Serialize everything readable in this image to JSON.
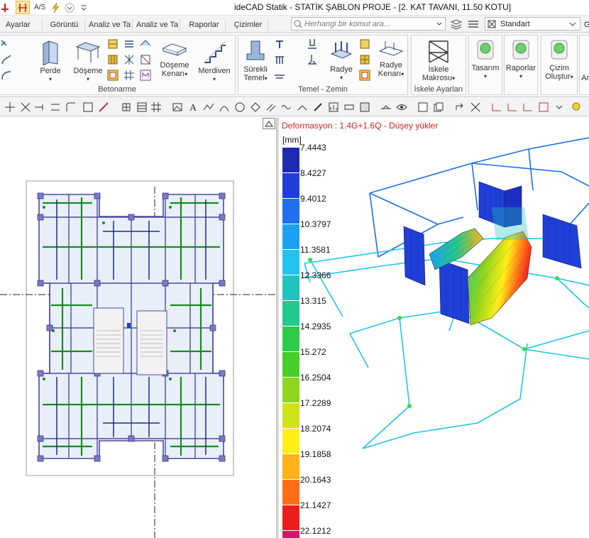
{
  "titlebar": {
    "title": "ideCAD Statik - STATİK ŞABLON PROJE - [2. KAT TAVANI, 11.50 KOTU]",
    "qa_text": "A/S"
  },
  "tabs": [
    "Ayarlar",
    "Görüntü",
    "Analiz ve Ta",
    "Analiz ve Ta",
    "Raporlar",
    "Çizimler"
  ],
  "search": {
    "placeholder": "Herhangi bir komut ara..."
  },
  "style_select": {
    "value": "Standart"
  },
  "ribbon": {
    "groups": {
      "betonarme": "Betonarme",
      "temel": "Temel - Zemin",
      "iskele": "İskele Ayarları"
    },
    "buttons": {
      "perde": "Perde",
      "doseme": "Döşeme",
      "doseme_kenari_1": "Döşeme",
      "doseme_kenari_2": "Kenarı",
      "merdiven": "Merdiven",
      "surekli_temel_1": "Sürekli",
      "surekli_temel_2": "Temel",
      "radye": "Radye",
      "radye_kenari_1": "Radye",
      "radye_kenari_2": "Kenarı",
      "iskele_makrosu_1": "İskele",
      "iskele_makrosu_2": "Makrosu",
      "tasarim": "Tasarım",
      "raporlar": "Raporlar",
      "cizim_olustur_1": "Çizim",
      "cizim_olustur_2": "Oluştur"
    }
  },
  "view3d": {
    "title": "Deformasyon : 1.4G+1.6Q  -  Düşey yükler",
    "unit": "[mm]",
    "legend": {
      "labels": [
        "7.4443",
        "8.4227",
        "9.4012",
        "10.3797",
        "11.3581",
        "12.3366",
        "13.315",
        "14.2935",
        "15.272",
        "16.2504",
        "17.2289",
        "18.2074",
        "19.1858",
        "20.1643",
        "21.1427",
        "22.1212"
      ],
      "colors": [
        "#1d2bb0",
        "#1f3fd8",
        "#1f6fee",
        "#1ea0f0",
        "#1fc4ec",
        "#1fc4be",
        "#22c98c",
        "#2ccc48",
        "#47cf28",
        "#8fd41f",
        "#cfe21b",
        "#ffee17",
        "#ffb317",
        "#ff6e17",
        "#ec1e1e",
        "#d9146e"
      ]
    }
  },
  "colors": {
    "accent": "#fde7a8",
    "panel": "#f3f3f3",
    "plan_beam": "#1a8a20",
    "plan_line": "#4a4a9a"
  }
}
